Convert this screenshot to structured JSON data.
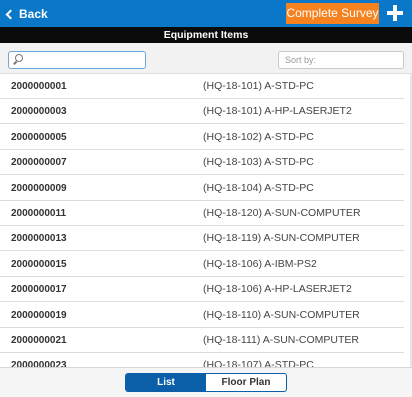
{
  "header": {
    "back_label": "Back",
    "survey_label": "Complete Survey",
    "section_title": "Equipment Items"
  },
  "filters": {
    "search_value": "",
    "sort_placeholder": "Sort by:"
  },
  "items": [
    {
      "code": "2000000001",
      "desc": "(HQ-18-101) A-STD-PC"
    },
    {
      "code": "2000000003",
      "desc": "(HQ-18-101) A-HP-LASERJET2"
    },
    {
      "code": "2000000005",
      "desc": "(HQ-18-102) A-STD-PC"
    },
    {
      "code": "2000000007",
      "desc": "(HQ-18-103) A-STD-PC"
    },
    {
      "code": "2000000009",
      "desc": "(HQ-18-104) A-STD-PC"
    },
    {
      "code": "2000000011",
      "desc": "(HQ-18-120) A-SUN-COMPUTER"
    },
    {
      "code": "2000000013",
      "desc": "(HQ-18-119) A-SUN-COMPUTER"
    },
    {
      "code": "2000000015",
      "desc": "(HQ-18-106) A-IBM-PS2"
    },
    {
      "code": "2000000017",
      "desc": "(HQ-18-106) A-HP-LASERJET2"
    },
    {
      "code": "2000000019",
      "desc": "(HQ-18-110) A-SUN-COMPUTER"
    },
    {
      "code": "2000000021",
      "desc": "(HQ-18-111) A-SUN-COMPUTER"
    },
    {
      "code": "2000000023",
      "desc": "(HQ-18-107) A-STD-PC"
    }
  ],
  "footer": {
    "list_label": "List",
    "floorplan_label": "Floor Plan"
  },
  "colors": {
    "header_blue": "#0a77c9",
    "accent_orange": "#f5821f",
    "section_black": "#0b0b0b"
  }
}
